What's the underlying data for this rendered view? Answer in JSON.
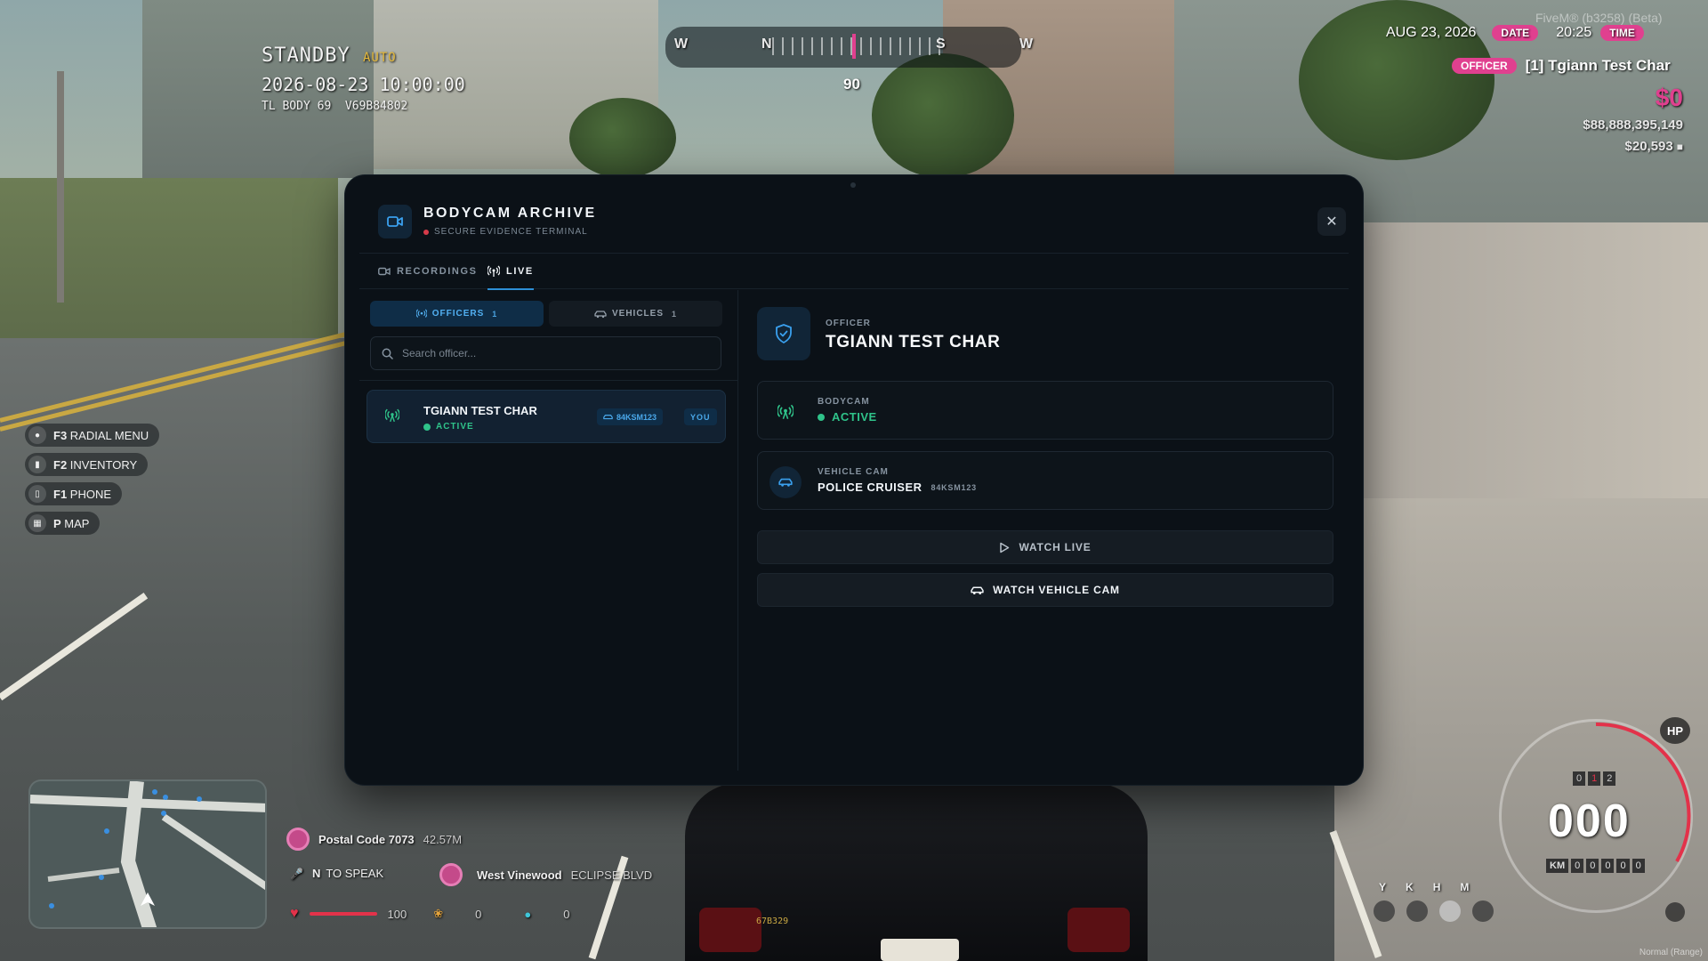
{
  "hud": {
    "standby": "STANDBY",
    "auto": "AUTO",
    "datetime": "2026-08-23 10:00:00",
    "device": "TL BODY 69  V69B84802",
    "compass": [
      "W",
      "N",
      "S",
      "W"
    ],
    "heading": "90",
    "server": "FiveM® (b3258) (Beta)",
    "date": "AUG 23, 2026",
    "date_label": "DATE",
    "time": "20:25",
    "time_label": "TIME",
    "job": "OFFICER",
    "player": "[1] Tgiann Test Char",
    "cash": "$0",
    "bank": "$88,888,395,149",
    "other_money": "$20,593",
    "keybinds": [
      {
        "key": "F3",
        "label": "RADIAL MENU"
      },
      {
        "key": "F2",
        "label": "INVENTORY"
      },
      {
        "key": "F1",
        "label": "PHONE"
      },
      {
        "key": "P",
        "label": "MAP"
      }
    ],
    "postal_label": "Postal Code 7073",
    "postal_distance": "42.57M",
    "speak_key": "N",
    "speak_label": "TO SPEAK",
    "area": "West Vinewood",
    "street": "ECLIPSE BLVD",
    "health": "100",
    "food": "0",
    "water": "0",
    "speed": "000",
    "gear": [
      "0",
      "1",
      "2"
    ],
    "odo_label": "KM",
    "odo": [
      "0",
      "0",
      "0",
      "0",
      "0"
    ],
    "hp_label": "HP",
    "indicator_keys": [
      "Y",
      "K",
      "H",
      "M"
    ],
    "mode": "Normal (Range)",
    "car_plate": "67B329"
  },
  "modal": {
    "title": "BODYCAM ARCHIVE",
    "subtitle": "SECURE EVIDENCE TERMINAL",
    "close_symbol": "✕",
    "tabs": [
      {
        "label": "RECORDINGS",
        "icon": "camera-icon"
      },
      {
        "label": "LIVE",
        "icon": "broadcast-icon"
      }
    ],
    "segments": {
      "officers_label": "OFFICERS",
      "officers_count": "1",
      "vehicles_label": "VEHICLES",
      "vehicles_count": "1"
    },
    "search_placeholder": "Search officer...",
    "officer_list": [
      {
        "name": "TGIANN TEST CHAR",
        "status": "ACTIVE",
        "plate": "84KSM123",
        "tag": "YOU"
      }
    ],
    "detail": {
      "kicker": "OFFICER",
      "name": "TGIANN TEST CHAR",
      "bodycam_label": "BODYCAM",
      "bodycam_status": "ACTIVE",
      "vehiclecam_label": "VEHICLE CAM",
      "vehicle_name": "POLICE CRUISER",
      "vehicle_plate": "84KSM123",
      "watch_live": "WATCH LIVE",
      "watch_vehicle": "WATCH VEHICLE CAM"
    },
    "colors": {
      "accent": "#2d8fd6",
      "active_green": "#2fc38a",
      "alert_red": "#d63b4a"
    }
  }
}
